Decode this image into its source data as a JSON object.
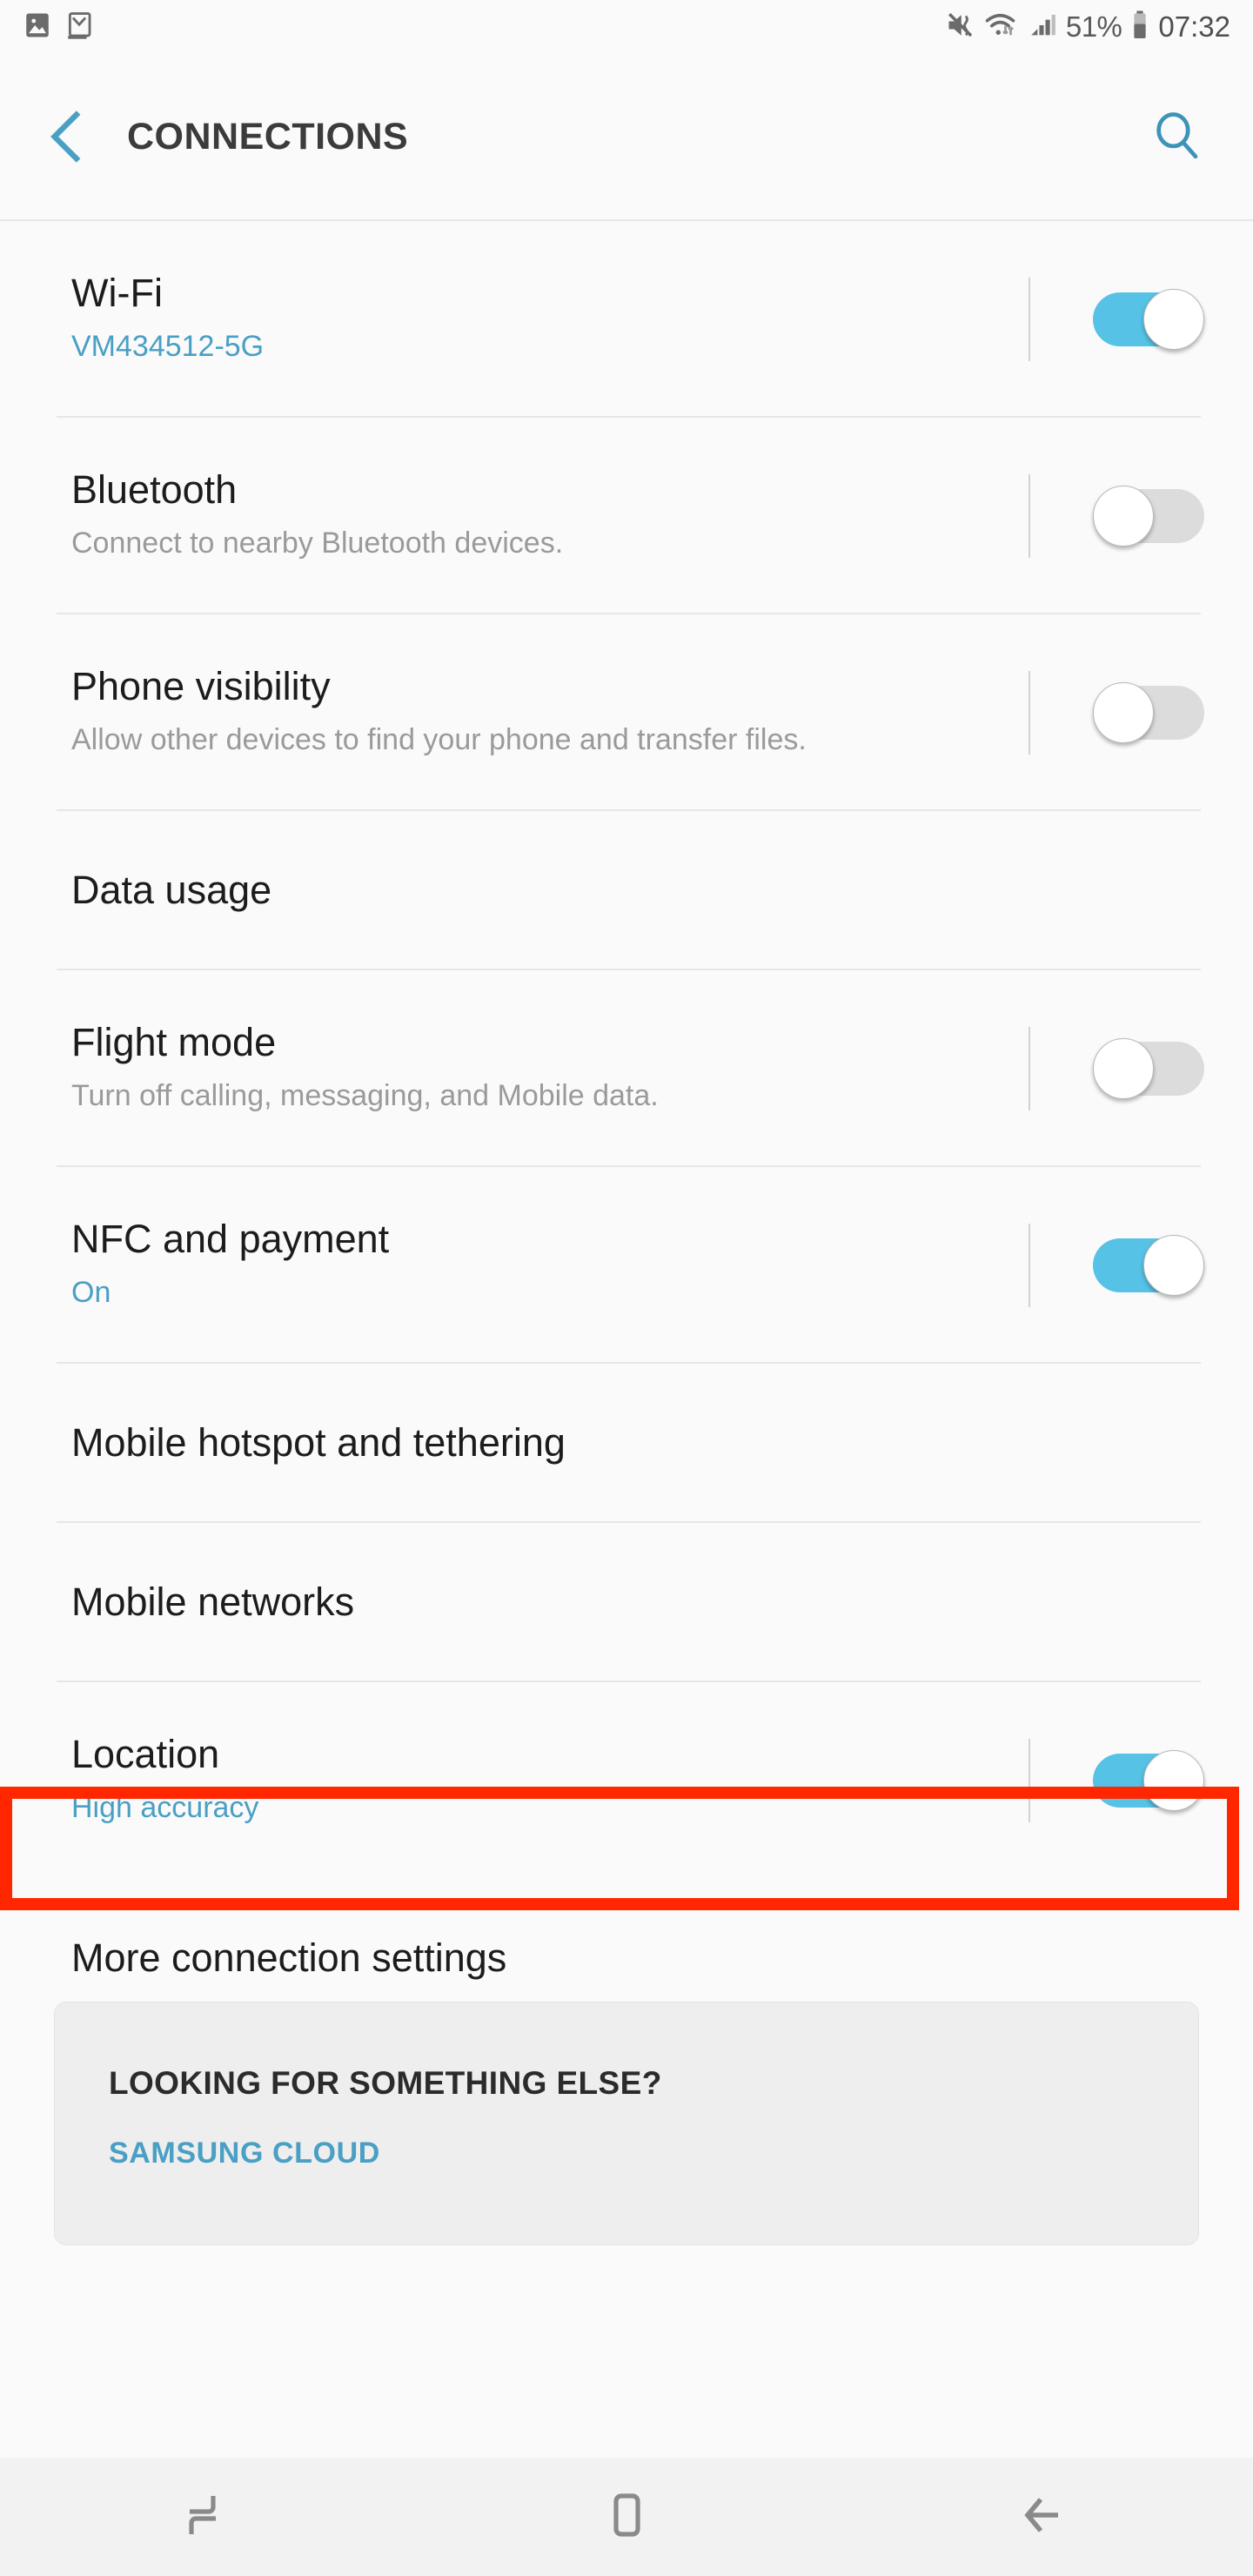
{
  "status_bar": {
    "left_icons": [
      "gallery-image-icon",
      "gmail-icon"
    ],
    "right_icons": [
      "mute-vibrate-icon",
      "wifi-icon",
      "signal-bars-icon",
      "battery-icon"
    ],
    "battery_percent": "51%",
    "time": "07:32"
  },
  "header": {
    "title": "CONNECTIONS",
    "back_icon": "back-chevron-icon",
    "search_icon": "search-icon",
    "accent_color": "#4a9fc4"
  },
  "settings": {
    "items": [
      {
        "label": "Wi-Fi",
        "sublabel": "VM434512-5G",
        "sublabel_style": "blue",
        "control": "toggle",
        "toggle_state": "on"
      },
      {
        "label": "Bluetooth",
        "sublabel": "Connect to nearby Bluetooth devices.",
        "sublabel_style": "grey",
        "control": "toggle",
        "toggle_state": "off"
      },
      {
        "label": "Phone visibility",
        "sublabel": "Allow other devices to find your phone and transfer files.",
        "sublabel_style": "grey",
        "control": "toggle",
        "toggle_state": "off"
      },
      {
        "label": "Data usage",
        "sublabel": "",
        "sublabel_style": "",
        "control": "none",
        "toggle_state": ""
      },
      {
        "label": "Flight mode",
        "sublabel": "Turn off calling, messaging, and Mobile data.",
        "sublabel_style": "grey",
        "control": "toggle",
        "toggle_state": "off"
      },
      {
        "label": "NFC and payment",
        "sublabel": "On",
        "sublabel_style": "blue",
        "control": "toggle",
        "toggle_state": "on"
      },
      {
        "label": "Mobile hotspot and tethering",
        "sublabel": "",
        "sublabel_style": "",
        "control": "none",
        "toggle_state": ""
      },
      {
        "label": "Mobile networks",
        "sublabel": "",
        "sublabel_style": "",
        "control": "none",
        "toggle_state": ""
      },
      {
        "label": "Location",
        "sublabel": "High accuracy",
        "sublabel_style": "blue",
        "control": "toggle",
        "toggle_state": "on"
      },
      {
        "label": "More connection settings",
        "sublabel": "",
        "sublabel_style": "",
        "control": "none",
        "toggle_state": ""
      }
    ]
  },
  "highlight": {
    "target_label": "More connection settings",
    "color": "#ff2600"
  },
  "footer_card": {
    "title": "LOOKING FOR SOMETHING ELSE?",
    "link": "SAMSUNG CLOUD",
    "link_color": "#4a9fc4"
  },
  "nav_bar": {
    "recents_icon": "recents-icon",
    "home_icon": "home-icon",
    "back_icon": "nav-back-arrow-icon"
  }
}
